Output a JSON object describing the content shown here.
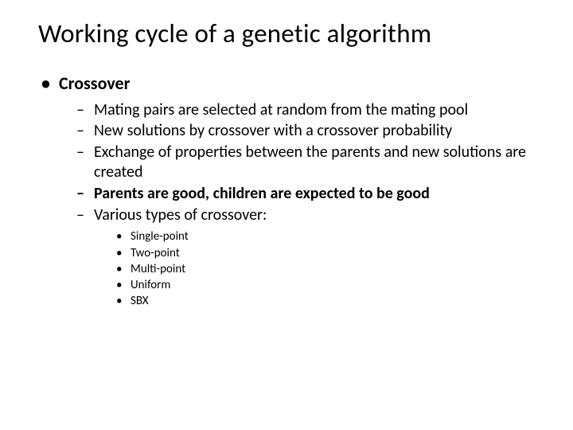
{
  "title": "Working cycle of a genetic algorithm",
  "bullet1": {
    "label": "Crossover",
    "items": [
      {
        "text": "Mating pairs are selected at random from the mating pool",
        "bold": false
      },
      {
        "text": "New solutions by crossover with a crossover probability",
        "bold": false
      },
      {
        "text": "Exchange of properties between the parents and new solutions are created",
        "bold": false
      },
      {
        "text": "Parents are good, children are expected to be good",
        "bold": true
      },
      {
        "text": "Various types of crossover:",
        "bold": false
      }
    ],
    "subitems": [
      "Single-point",
      "Two-point",
      "Multi-point",
      "Uniform",
      "SBX"
    ]
  }
}
